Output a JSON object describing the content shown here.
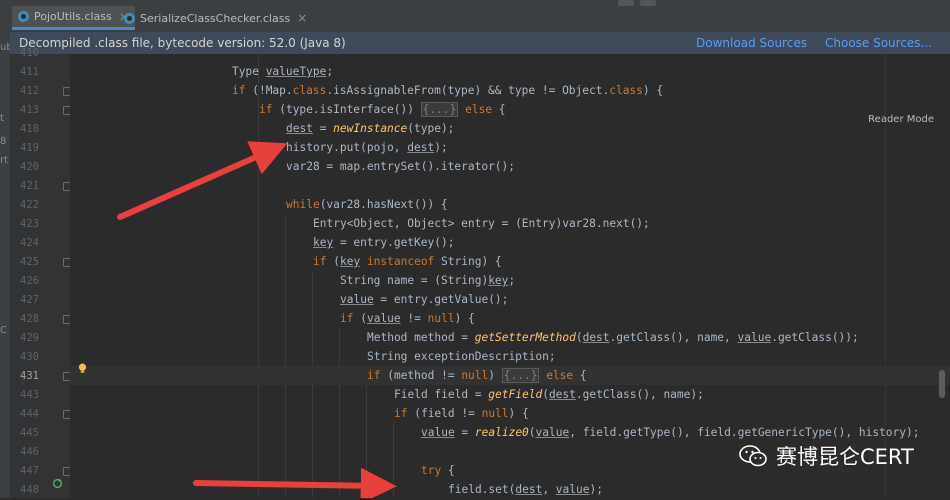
{
  "tabs": [
    {
      "label": "PojoUtils.class",
      "active": true
    },
    {
      "label": "SerializeClassChecker.class",
      "active": false
    }
  ],
  "banner": {
    "message": "Decompiled .class file, bytecode version: 52.0 (Java 8)",
    "download_sources": "Download Sources",
    "choose_sources": "Choose Sources..."
  },
  "reader_mode": "Reader Mode",
  "left_strip_fragments": [
    "ub",
    "t",
    "8",
    "rt",
    "C"
  ],
  "line_numbers": [
    "411",
    "412",
    "413",
    "418",
    "419",
    "420",
    "421",
    "422",
    "423",
    "424",
    "425",
    "426",
    "427",
    "428",
    "429",
    "430",
    "431",
    "443",
    "444",
    "445",
    "446",
    "447",
    "448"
  ],
  "current_line": "431",
  "watermark": "赛博昆仑CERT",
  "colors": {
    "keyword": "#cc7832",
    "method": "#ffc66d",
    "text": "#a9b7c6",
    "arrow": "#e8403a",
    "link": "#589df6"
  },
  "icons": [
    "class-file-icon",
    "close-icon",
    "fold-icon",
    "lightbulb-icon",
    "recursion-icon",
    "wechat-icon"
  ]
}
